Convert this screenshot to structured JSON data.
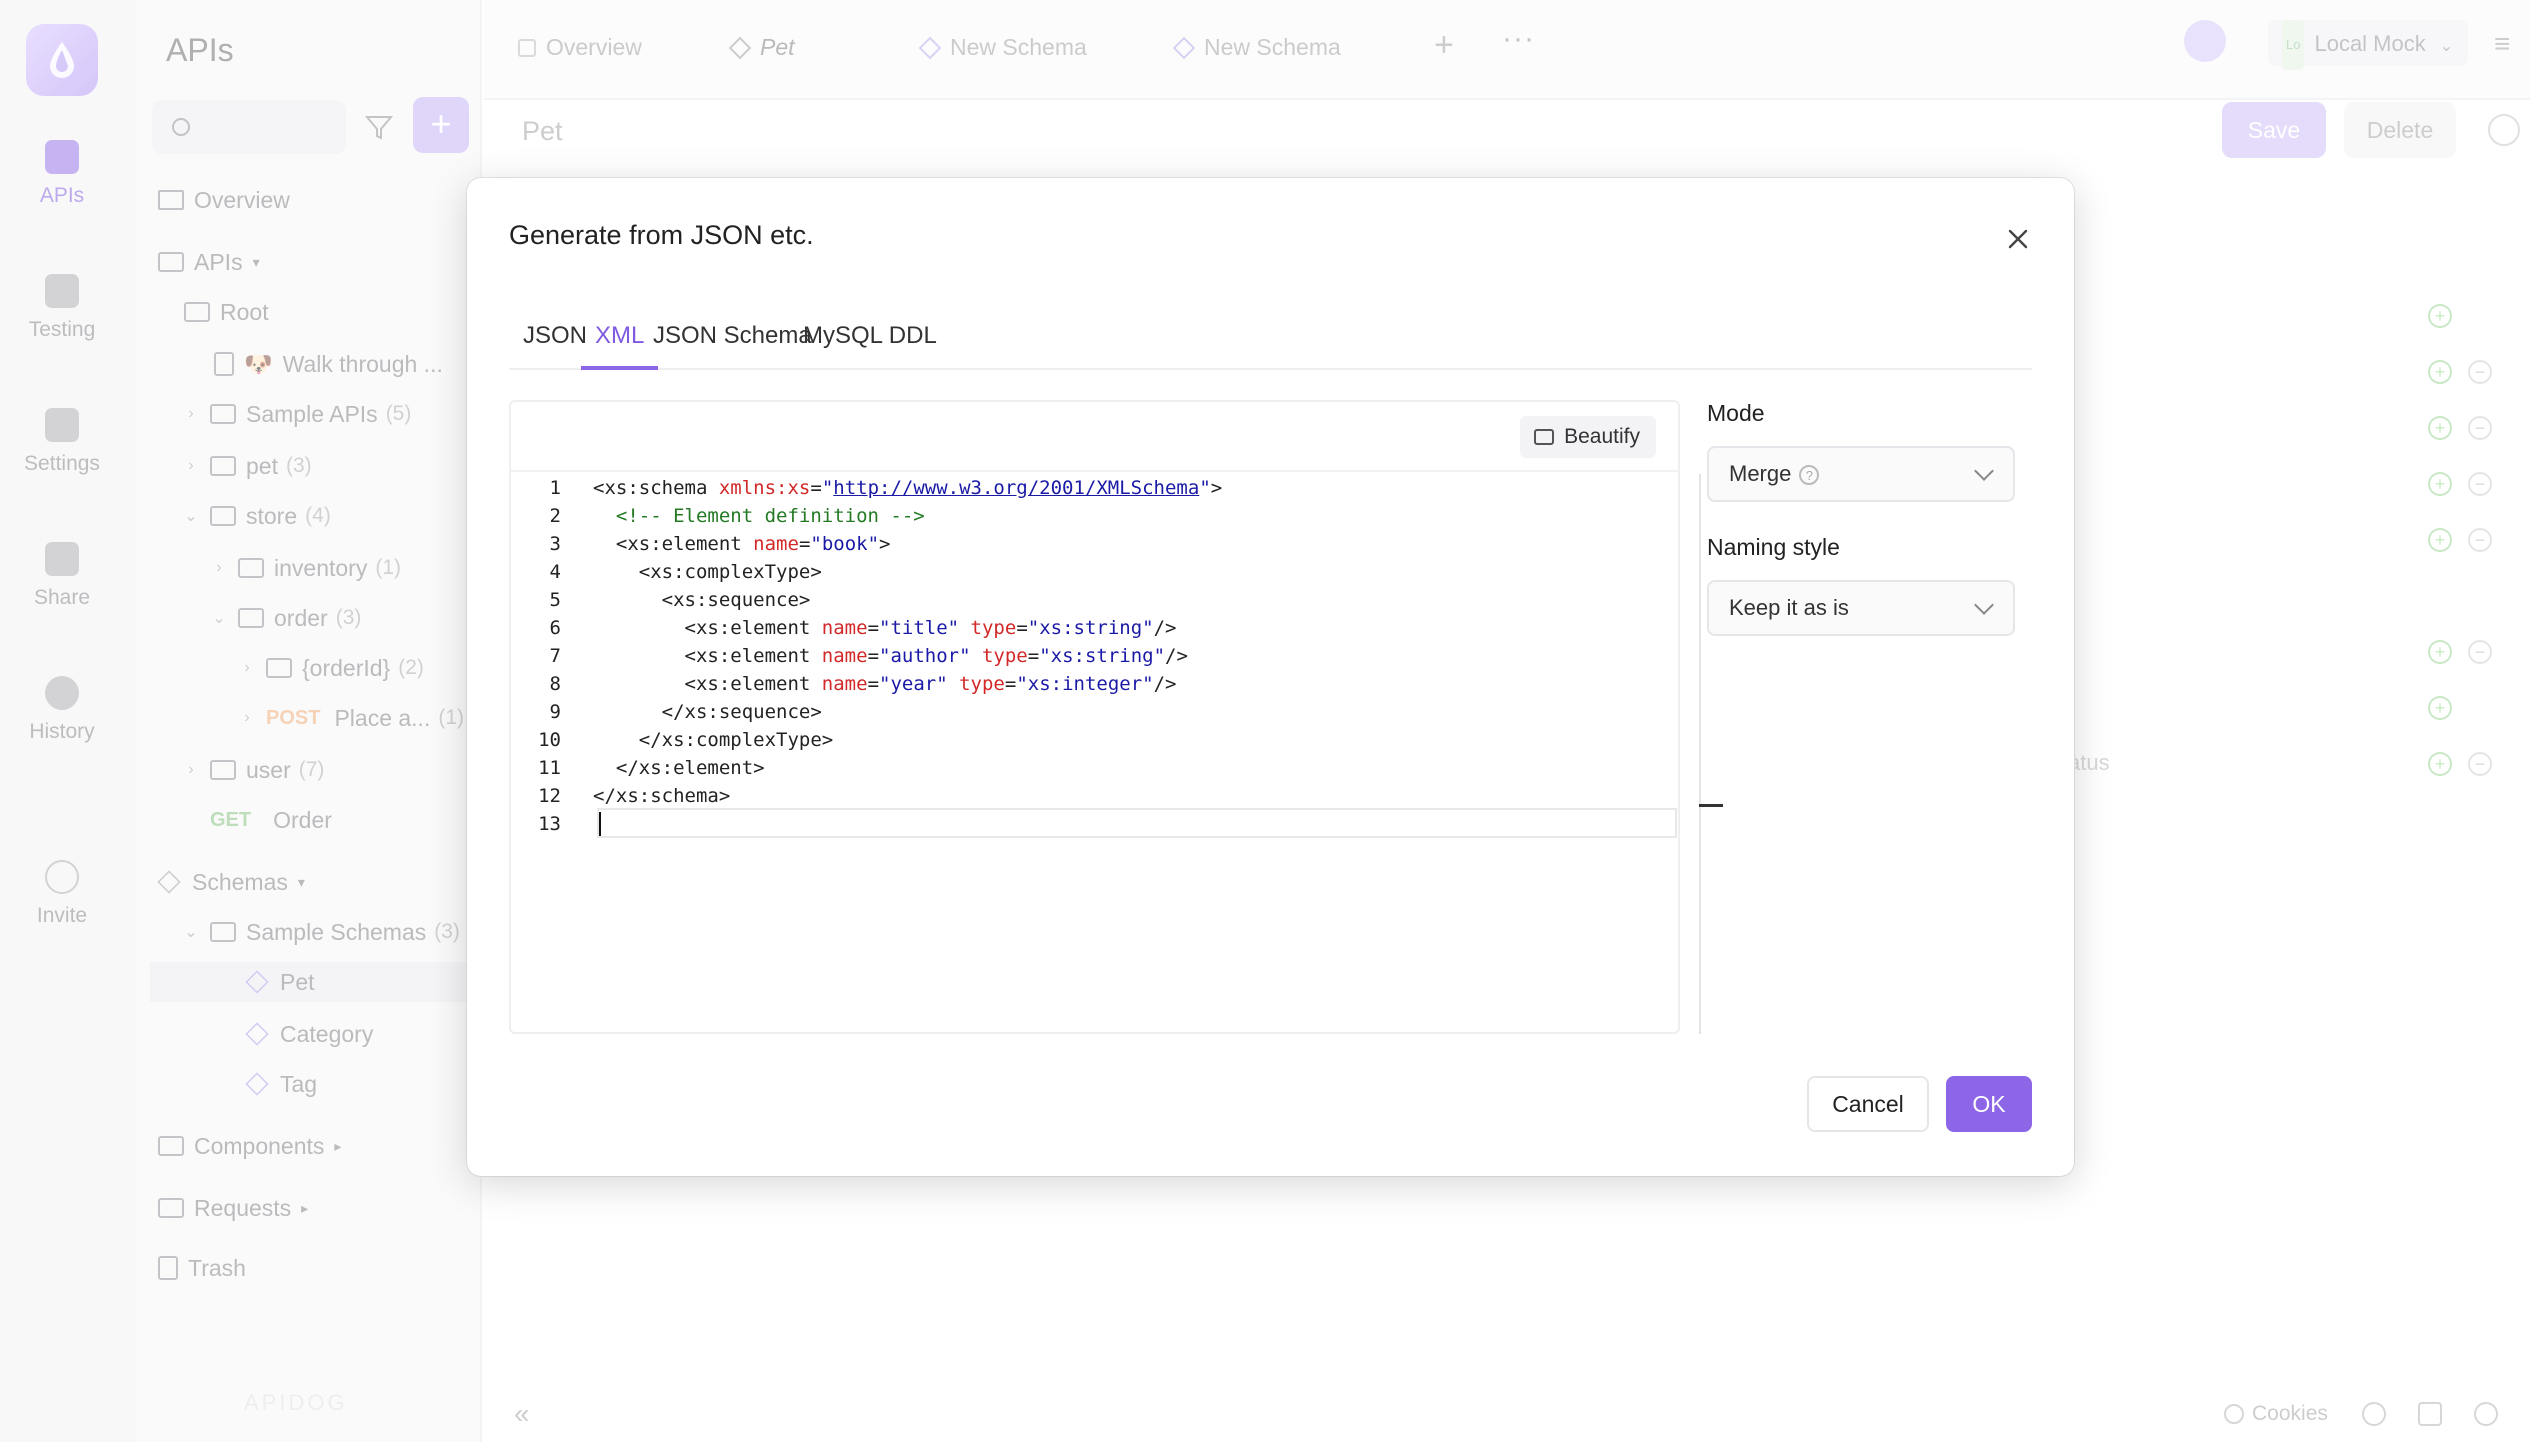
{
  "rail": {
    "items": [
      {
        "label": "APIs",
        "icon": "api-icon"
      },
      {
        "label": "Testing",
        "icon": "testing-icon"
      },
      {
        "label": "Settings",
        "icon": "settings-icon"
      },
      {
        "label": "Share",
        "icon": "share-icon"
      },
      {
        "label": "History",
        "icon": "history-icon"
      },
      {
        "label": "Invite",
        "icon": "invite-icon"
      }
    ]
  },
  "tree": {
    "title": "APIs",
    "overview": "Overview",
    "apis": "APIs",
    "root": "Root",
    "walk": "Walk through ...",
    "sample_apis": {
      "label": "Sample APIs",
      "count": "(5)"
    },
    "pet": {
      "label": "pet",
      "count": "(3)"
    },
    "store": {
      "label": "store",
      "count": "(4)"
    },
    "inventory": {
      "label": "inventory",
      "count": "(1)"
    },
    "order": {
      "label": "order",
      "count": "(3)"
    },
    "orderId": {
      "label": "{orderId}",
      "count": "(2)"
    },
    "place": {
      "method": "POST",
      "label": "Place a...",
      "count": "(1)"
    },
    "user": {
      "label": "user",
      "count": "(7)"
    },
    "order_get": {
      "method": "GET",
      "label": "Order"
    },
    "schemas": "Schemas",
    "sample_schemas": {
      "label": "Sample Schemas",
      "count": "(3)"
    },
    "schema_pet": "Pet",
    "schema_category": "Category",
    "schema_tag": "Tag",
    "components": "Components",
    "requests": "Requests",
    "trash": "Trash",
    "footer_logo": "APIDOG"
  },
  "tabs": {
    "items": [
      "Overview",
      "Pet",
      "New Schema",
      "New Schema"
    ],
    "env": "Local Mock",
    "env_badge": "Lo"
  },
  "content": {
    "title": "Pet",
    "save": "Save",
    "delete": "Delete",
    "status_partial": "atus"
  },
  "status_bar": {
    "cookies": "Cookies"
  },
  "modal": {
    "title": "Generate from JSON etc.",
    "tabs": [
      "JSON",
      "XML",
      "JSON Schema",
      "MySQL DDL"
    ],
    "active_tab": "XML",
    "beautify": "Beautify",
    "mode_label": "Mode",
    "mode_value": "Merge",
    "naming_label": "Naming style",
    "naming_value": "Keep it as is",
    "cancel": "Cancel",
    "ok": "OK",
    "code_lines": [
      "1",
      "2",
      "3",
      "4",
      "5",
      "6",
      "7",
      "8",
      "9",
      "10",
      "11",
      "12",
      "13"
    ],
    "code": {
      "l1_tag": "<xs:schema ",
      "l1_attr": "xmlns:xs",
      "l1_eq": "=",
      "l1_url": "http://www.w3.org/2001/XMLSchema",
      "l1_end": ">",
      "l2": "<!-- Element definition -->",
      "l3_tag": "<xs:element ",
      "l3_attr": "name",
      "l3_val": "\"book\"",
      "l4": "<xs:complexType>",
      "l5": "<xs:sequence>",
      "l6_name": "\"title\"",
      "l6_type": "\"xs:string\"",
      "l7_name": "\"author\"",
      "l7_type": "\"xs:string\"",
      "l8_name": "\"year\"",
      "l8_type": "\"xs:integer\"",
      "l9": "</xs:sequence>",
      "l10": "</xs:complexType>",
      "l11": "</xs:element>",
      "l12": "</xs:schema>"
    }
  },
  "colors": {
    "accent": "#8d66e8",
    "xml_attr": "#d22828",
    "xml_string": "#1a1aa6",
    "xml_comment": "#237a23"
  }
}
